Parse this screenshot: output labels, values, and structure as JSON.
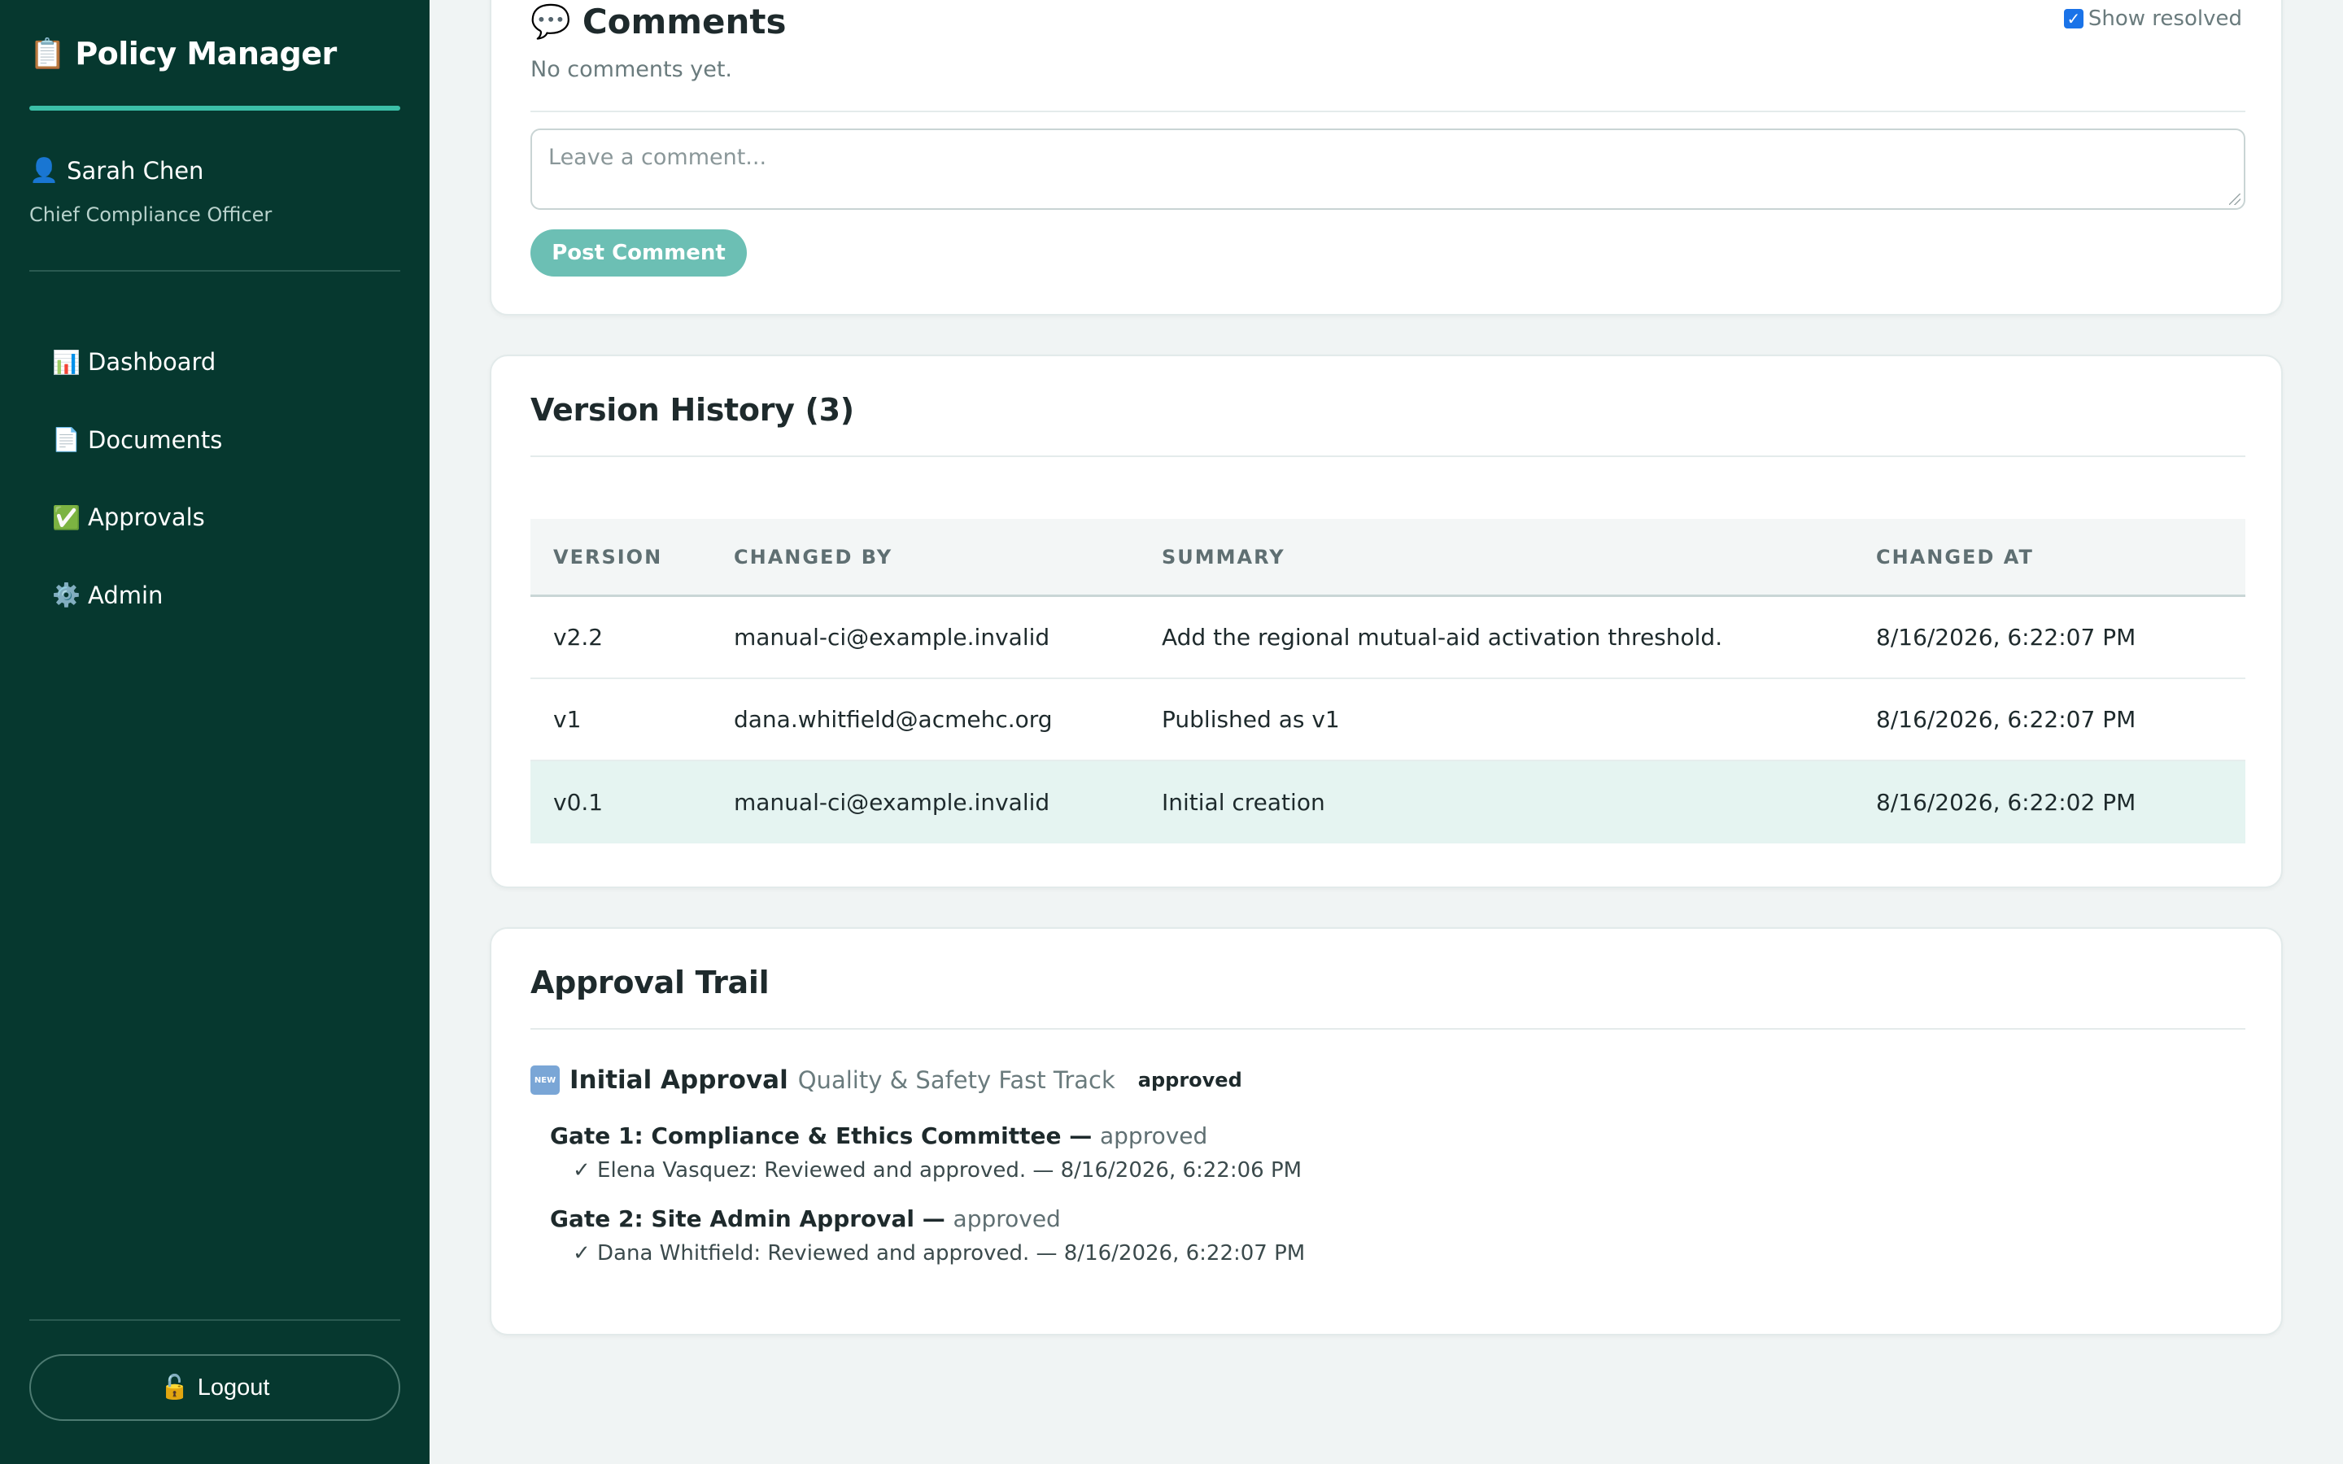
{
  "app": {
    "icon": "clipboard-icon",
    "title": "Policy Manager"
  },
  "user": {
    "icon": "person-icon",
    "name": "Sarah Chen",
    "role": "Chief Compliance Officer"
  },
  "nav": [
    {
      "icon": "📊",
      "label": "Dashboard"
    },
    {
      "icon": "📄",
      "label": "Documents"
    },
    {
      "icon": "✅",
      "label": "Approvals"
    },
    {
      "icon": "⚙️",
      "label": "Admin"
    }
  ],
  "logout": {
    "icon": "🔓",
    "label": "Logout"
  },
  "comments": {
    "icon": "💬",
    "title": "Comments",
    "show_resolved_label": "Show resolved",
    "show_resolved_checked": true,
    "empty_text": "No comments yet.",
    "placeholder": "Leave a comment...",
    "post_label": "Post Comment"
  },
  "versions": {
    "title": "Version History (3)",
    "headers": [
      "VERSION",
      "CHANGED BY",
      "SUMMARY",
      "CHANGED AT"
    ],
    "rows": [
      {
        "version": "v2.2",
        "changed_by": "manual-ci@example.invalid",
        "summary": "Add the regional mutual-aid activation threshold.",
        "changed_at": "8/16/2026, 6:22:07 PM"
      },
      {
        "version": "v1",
        "changed_by": "dana.whitfield@acmehc.org",
        "summary": "Published as v1",
        "changed_at": "8/16/2026, 6:22:07 PM"
      },
      {
        "version": "v0.1",
        "changed_by": "manual-ci@example.invalid",
        "summary": "Initial creation",
        "changed_at": "8/16/2026, 6:22:02 PM"
      }
    ]
  },
  "approvals": {
    "title": "Approval Trail",
    "trail": {
      "icon": "NEW",
      "name": "Initial Approval",
      "flow": "Quality & Safety Fast Track",
      "status": "approved"
    },
    "gates": [
      {
        "name": "Gate 1: Compliance & Ethics Committee",
        "sep": " — ",
        "status": "approved",
        "entry": "✓ Elena Vasquez: Reviewed and approved. — 8/16/2026, 6:22:06 PM"
      },
      {
        "name": "Gate 2: Site Admin Approval",
        "sep": " — ",
        "status": "approved",
        "entry": "✓ Dana Whitfield: Reviewed and approved. — 8/16/2026, 6:22:07 PM"
      }
    ]
  }
}
